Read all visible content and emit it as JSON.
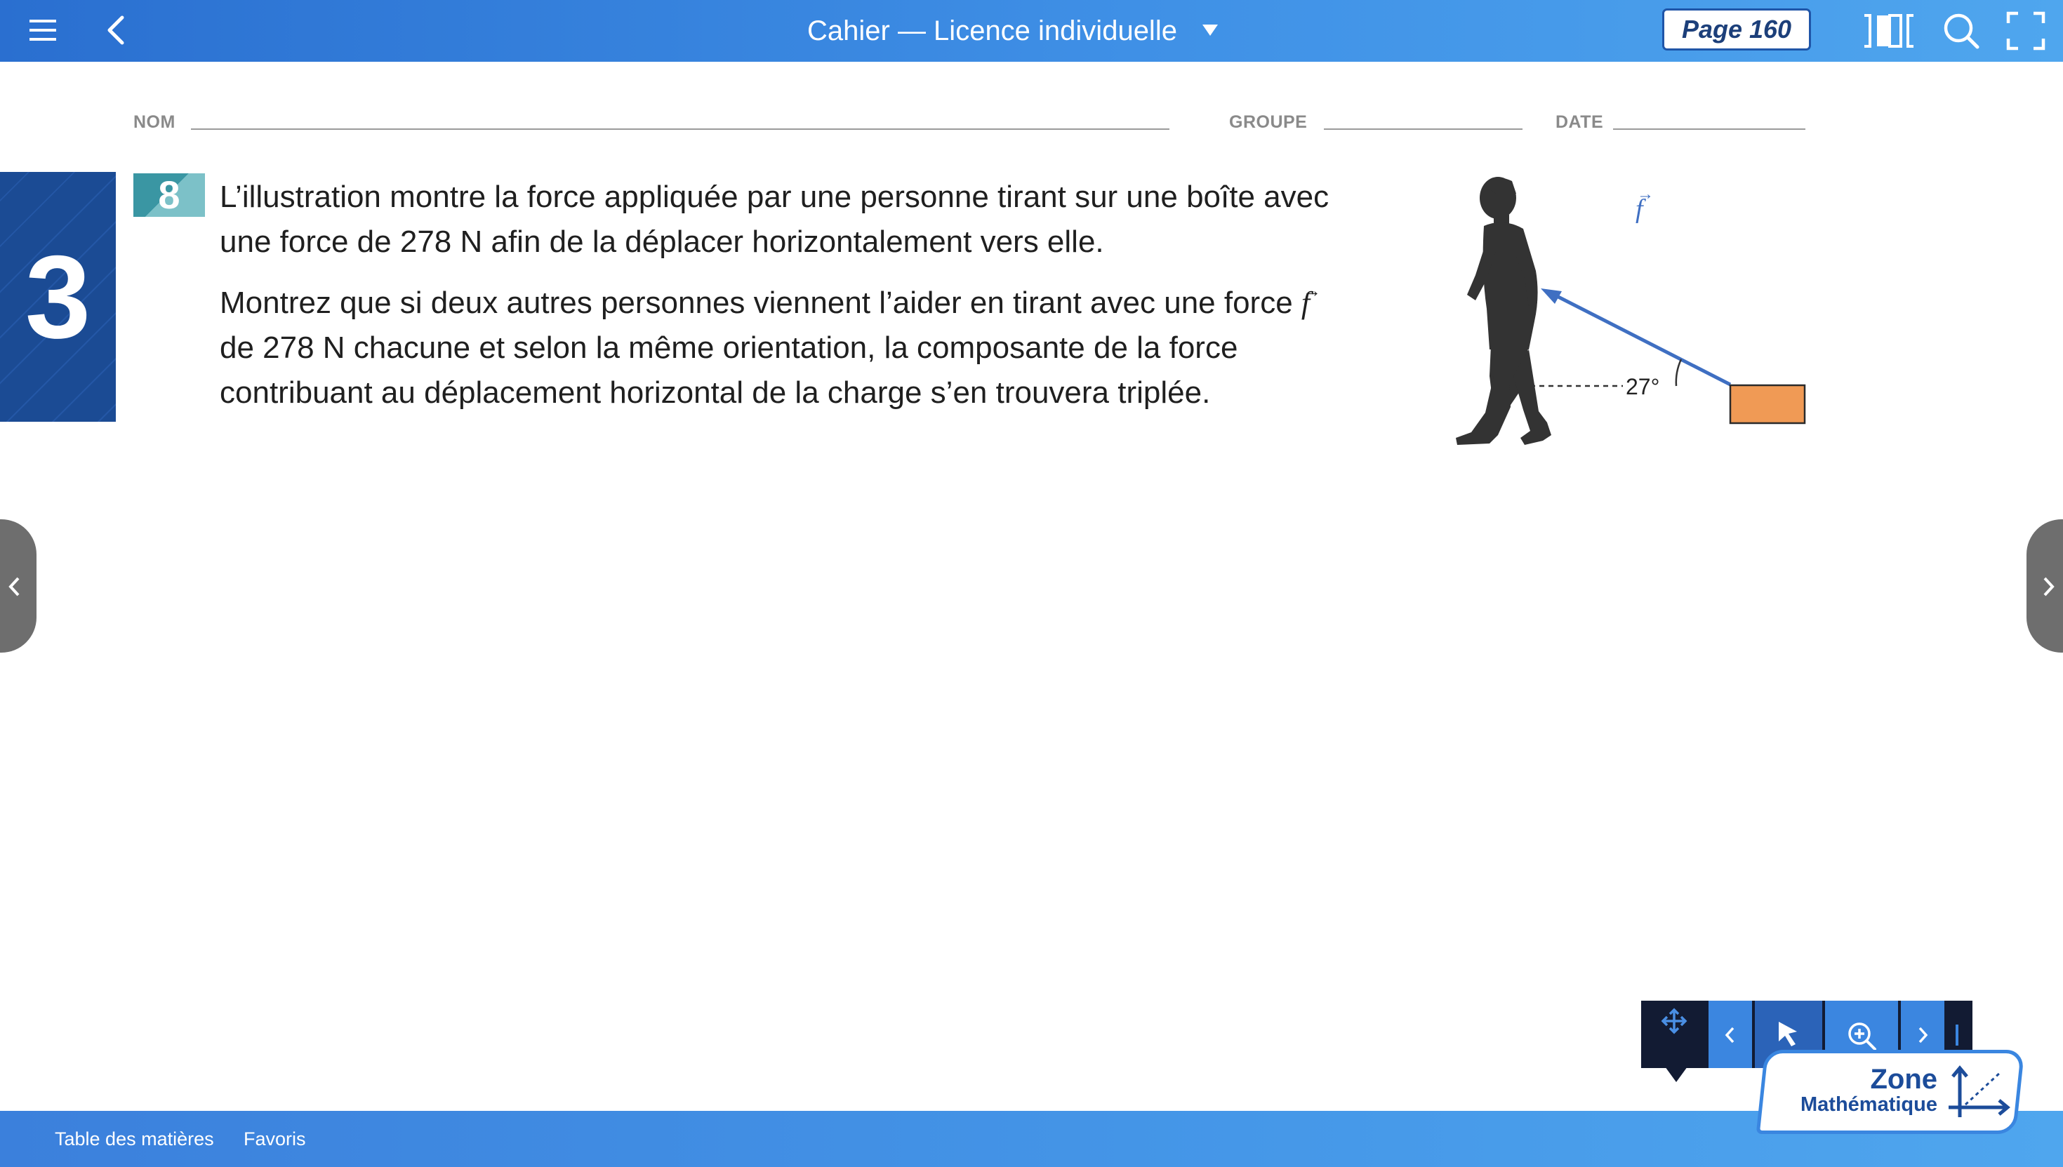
{
  "topbar": {
    "title": "Cahier — Licence individuelle",
    "page_label": "Page 160",
    "icons": {
      "menu": "hamburger-menu-icon",
      "back": "chevron-left-icon",
      "dropdown": "caret-down-icon",
      "view": "two-page-view-icon",
      "search": "search-icon",
      "fullscreen": "fullscreen-icon"
    }
  },
  "page_header": {
    "name_label": "NOM",
    "group_label": "GROUPE",
    "date_label": "DATE"
  },
  "chapter": {
    "number": "3"
  },
  "problem": {
    "number": "8",
    "para1_line1": "L’illustration montre la force appliquée par une personne tirant sur une boîte avec",
    "para1_line2": "une force de 278 N afin de la déplacer horizontalement vers elle.",
    "para2_line1": "Montrez que si deux autres personnes viennent l’aider en tirant avec une force",
    "para2_line1_vec": "f",
    "para2_line2": "de 278 N chacune et selon la même orientation, la composante de la force",
    "para2_line3": "contribuant au déplacement horizontal de la charge s’en trouvera triplée."
  },
  "illustration": {
    "vector_label": "f",
    "vector_arrow": "→",
    "angle_label": "27°",
    "angle_deg": 27,
    "colors": {
      "silhouette": "#333333",
      "arrow": "#3f6fc2",
      "box_fill": "#f09a55",
      "box_stroke": "#2a2a2a"
    }
  },
  "nav": {
    "prev_icon": "chevron-left-icon",
    "next_icon": "chevron-right-icon"
  },
  "float_toolbar": {
    "icons": [
      "move-icon",
      "chevron-left-icon",
      "pointer-icon",
      "zoom-in-icon",
      "chevron-right-icon"
    ]
  },
  "bottombar": {
    "toc_label": "Table des matières",
    "favorites_label": "Favoris"
  },
  "zone_math": {
    "title": "Zone",
    "subtitle": "Mathématique"
  },
  "colors": {
    "topbar_start": "#2a6fd0",
    "topbar_end": "#4fa6ee",
    "chapter_tab": "#1b4b94",
    "badge": "#3a96a3",
    "toolbar_dark": "#121b33",
    "toolbar_blue": "#3b86e0"
  }
}
